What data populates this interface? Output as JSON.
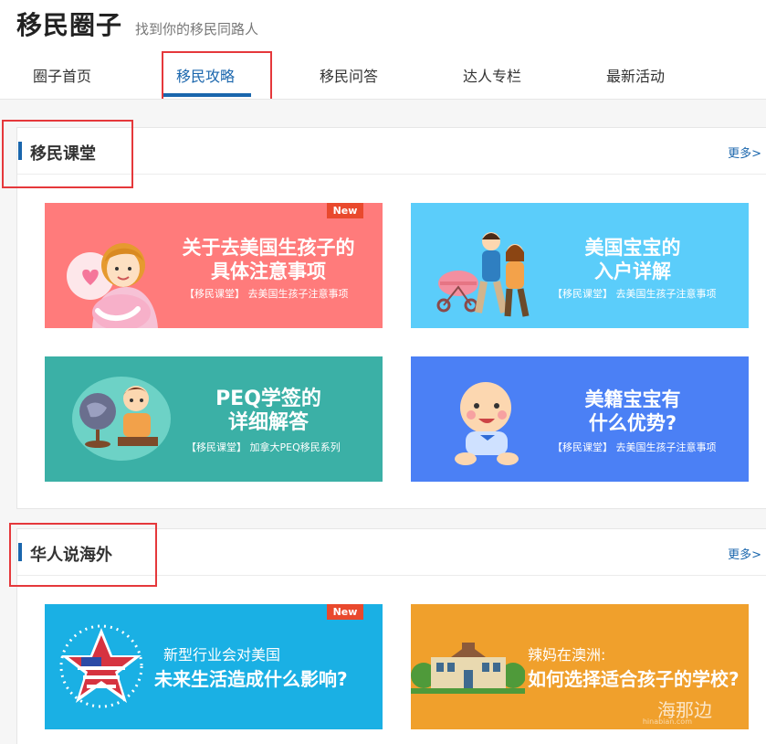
{
  "header": {
    "brand": "移民圈子",
    "slogan": "找到你的移民同路人",
    "nav": [
      "圈子首页",
      "移民攻略",
      "移民问答",
      "达人专栏",
      "最新活动"
    ]
  },
  "sections": [
    {
      "title": "移民课堂",
      "more": "更多>",
      "cards": [
        {
          "title_l1": "关于去美国生孩子的",
          "title_l2": "具体注意事项",
          "subtitle": "【移民课堂】 去美国生孩子注意事项",
          "badge": "New",
          "bg": "#ff7b7b"
        },
        {
          "title_l1": "美国宝宝的",
          "title_l2": "入户详解",
          "subtitle": "【移民课堂】 去美国生孩子注意事项",
          "bg": "#5bcdfa"
        },
        {
          "title_l1": "PEQ学签的",
          "title_l2": "详细解答",
          "subtitle": "【移民课堂】 加拿大PEQ移民系列",
          "bg": "#3bb0a6"
        },
        {
          "title_l1": "美籍宝宝有",
          "title_l2": "什么优势?",
          "subtitle": "【移民课堂】 去美国生孩子注意事项",
          "bg": "#4b80f5"
        }
      ]
    },
    {
      "title": "华人说海外",
      "more": "更多>",
      "cards": [
        {
          "line1": "新型行业会对美国",
          "line2": "未来生活造成什么影响?",
          "badge": "New",
          "bg": "#1ab0e4"
        },
        {
          "line1": "辣妈在澳洲:",
          "line2": "如何选择适合孩子的学校?",
          "watermark": "海那边",
          "watermark_sub": "hinabian.com",
          "bg": "#f0a02c"
        }
      ]
    }
  ],
  "icons": [
    "heart-icon",
    "star-flag-icon",
    "building-icon",
    "globe-icon"
  ]
}
